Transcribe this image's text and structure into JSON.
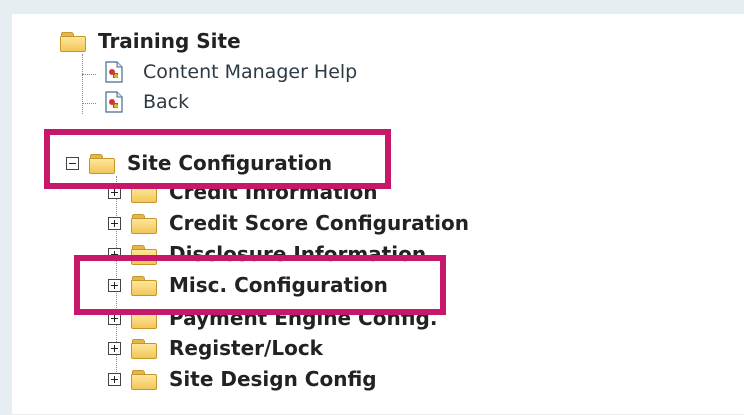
{
  "tree": {
    "root": {
      "label": "Training Site"
    },
    "links": [
      {
        "label": "Content Manager Help"
      },
      {
        "label": "Back"
      }
    ],
    "site_configuration": {
      "label": "Site Configuration"
    },
    "children": [
      {
        "label": "Credit Information"
      },
      {
        "label": "Credit Score Configuration"
      },
      {
        "label": "Disclosure Information"
      },
      {
        "label": "Misc. Configuration"
      },
      {
        "label": "Payment Engine Config."
      },
      {
        "label": "Register/Lock"
      },
      {
        "label": "Site Design Config"
      }
    ]
  },
  "colors": {
    "highlight": "#c7176a",
    "folder": "#f2c65a",
    "background": "#e6eef2"
  },
  "icons": {
    "folder": "folder-icon",
    "page": "page-icon",
    "expand": "plus-box-icon",
    "collapse": "minus-box-icon"
  }
}
